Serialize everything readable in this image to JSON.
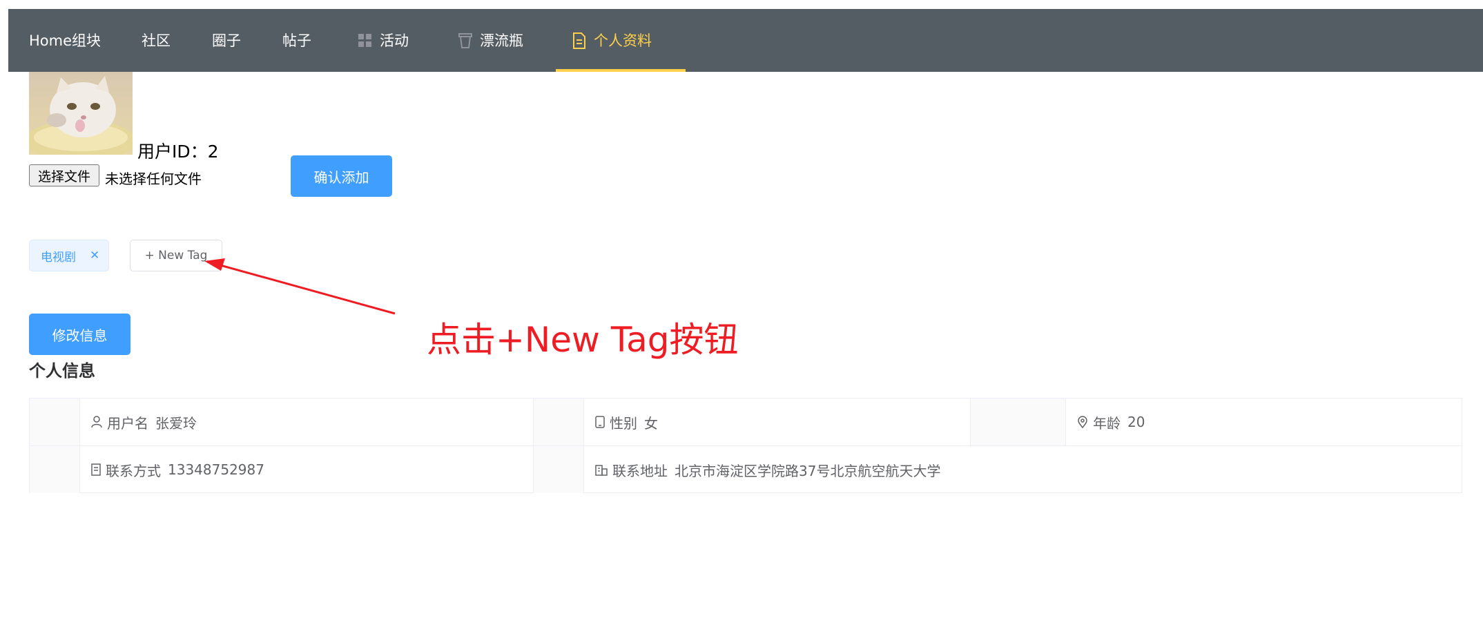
{
  "nav": {
    "items": [
      {
        "label": "Home组块"
      },
      {
        "label": "社区"
      },
      {
        "label": "圈子"
      },
      {
        "label": "帖子"
      },
      {
        "label": "活动",
        "icon": "grid-icon"
      },
      {
        "label": "漂流瓶",
        "icon": "cup-icon"
      },
      {
        "label": "个人资料",
        "icon": "document-icon",
        "active": true
      }
    ],
    "text_color": "#ffffff",
    "active_color": "#ffd04b",
    "background": "#545c64"
  },
  "profile": {
    "userid_label": "用户ID：2",
    "file_button": "选择文件",
    "file_status": "未选择任何文件",
    "confirm_button": "确认添加",
    "tags": [
      {
        "label": "电视剧"
      }
    ],
    "new_tag_button": "+ New Tag",
    "edit_button": "修改信息"
  },
  "annotation": {
    "text": "点击+New Tag按钮",
    "color": "#ee1d23"
  },
  "info": {
    "title": "个人信息",
    "rows": [
      [
        {
          "label": "用户名",
          "value": "张爱玲",
          "icon": "user-icon"
        },
        {
          "label": "性别",
          "value": "女",
          "icon": "mobile-icon"
        },
        {
          "label": "年龄",
          "value": "20",
          "icon": "location-icon"
        }
      ],
      [
        {
          "label": "联系方式",
          "value": "13348752987",
          "icon": "tickets-icon"
        },
        {
          "label": "联系地址",
          "value": "北京市海淀区学院路37号北京航空航天大学",
          "icon": "office-building-icon"
        }
      ]
    ]
  },
  "colors": {
    "primary": "#409eff",
    "tag_bg": "#ecf5ff"
  }
}
